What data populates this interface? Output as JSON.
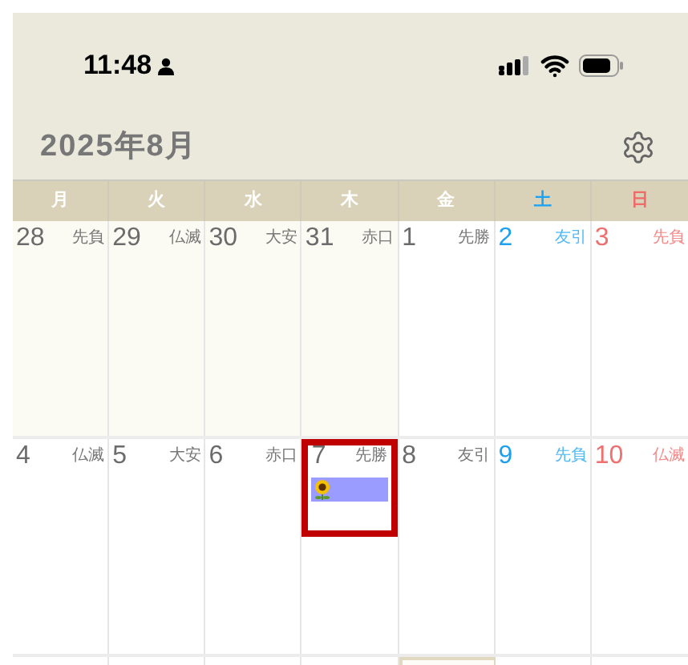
{
  "status_bar": {
    "time": "11:48"
  },
  "header": {
    "title": "2025年8月"
  },
  "weekdays": [
    {
      "label": "月",
      "kind": "weekday"
    },
    {
      "label": "火",
      "kind": "weekday"
    },
    {
      "label": "水",
      "kind": "weekday"
    },
    {
      "label": "木",
      "kind": "weekday"
    },
    {
      "label": "金",
      "kind": "weekday"
    },
    {
      "label": "土",
      "kind": "saturday"
    },
    {
      "label": "日",
      "kind": "sunday"
    }
  ],
  "weeks": [
    {
      "days": [
        {
          "date": "28",
          "rokuyo": "先負",
          "in_month": false
        },
        {
          "date": "29",
          "rokuyo": "仏滅",
          "in_month": false
        },
        {
          "date": "30",
          "rokuyo": "大安",
          "in_month": false
        },
        {
          "date": "31",
          "rokuyo": "赤口",
          "in_month": false
        },
        {
          "date": "1",
          "rokuyo": "先勝",
          "in_month": true
        },
        {
          "date": "2",
          "rokuyo": "友引",
          "in_month": true
        },
        {
          "date": "3",
          "rokuyo": "先負",
          "in_month": true
        }
      ]
    },
    {
      "days": [
        {
          "date": "4",
          "rokuyo": "仏滅",
          "in_month": true
        },
        {
          "date": "5",
          "rokuyo": "大安",
          "in_month": true
        },
        {
          "date": "6",
          "rokuyo": "赤口",
          "in_month": true
        },
        {
          "date": "7",
          "rokuyo": "先勝",
          "in_month": true,
          "framed": true,
          "events": [
            {
              "kind": "sunflower",
              "color": "#9b9cff"
            }
          ]
        },
        {
          "date": "8",
          "rokuyo": "友引",
          "in_month": true
        },
        {
          "date": "9",
          "rokuyo": "先負",
          "in_month": true
        },
        {
          "date": "10",
          "rokuyo": "仏滅",
          "in_month": true
        }
      ]
    }
  ],
  "next_week": [
    {
      "today": false
    },
    {
      "today": false
    },
    {
      "today": false
    },
    {
      "today": false
    },
    {
      "today": true
    },
    {
      "today": false
    },
    {
      "today": false
    }
  ],
  "annotation": {
    "kind": "frame",
    "color": "#c00000"
  }
}
